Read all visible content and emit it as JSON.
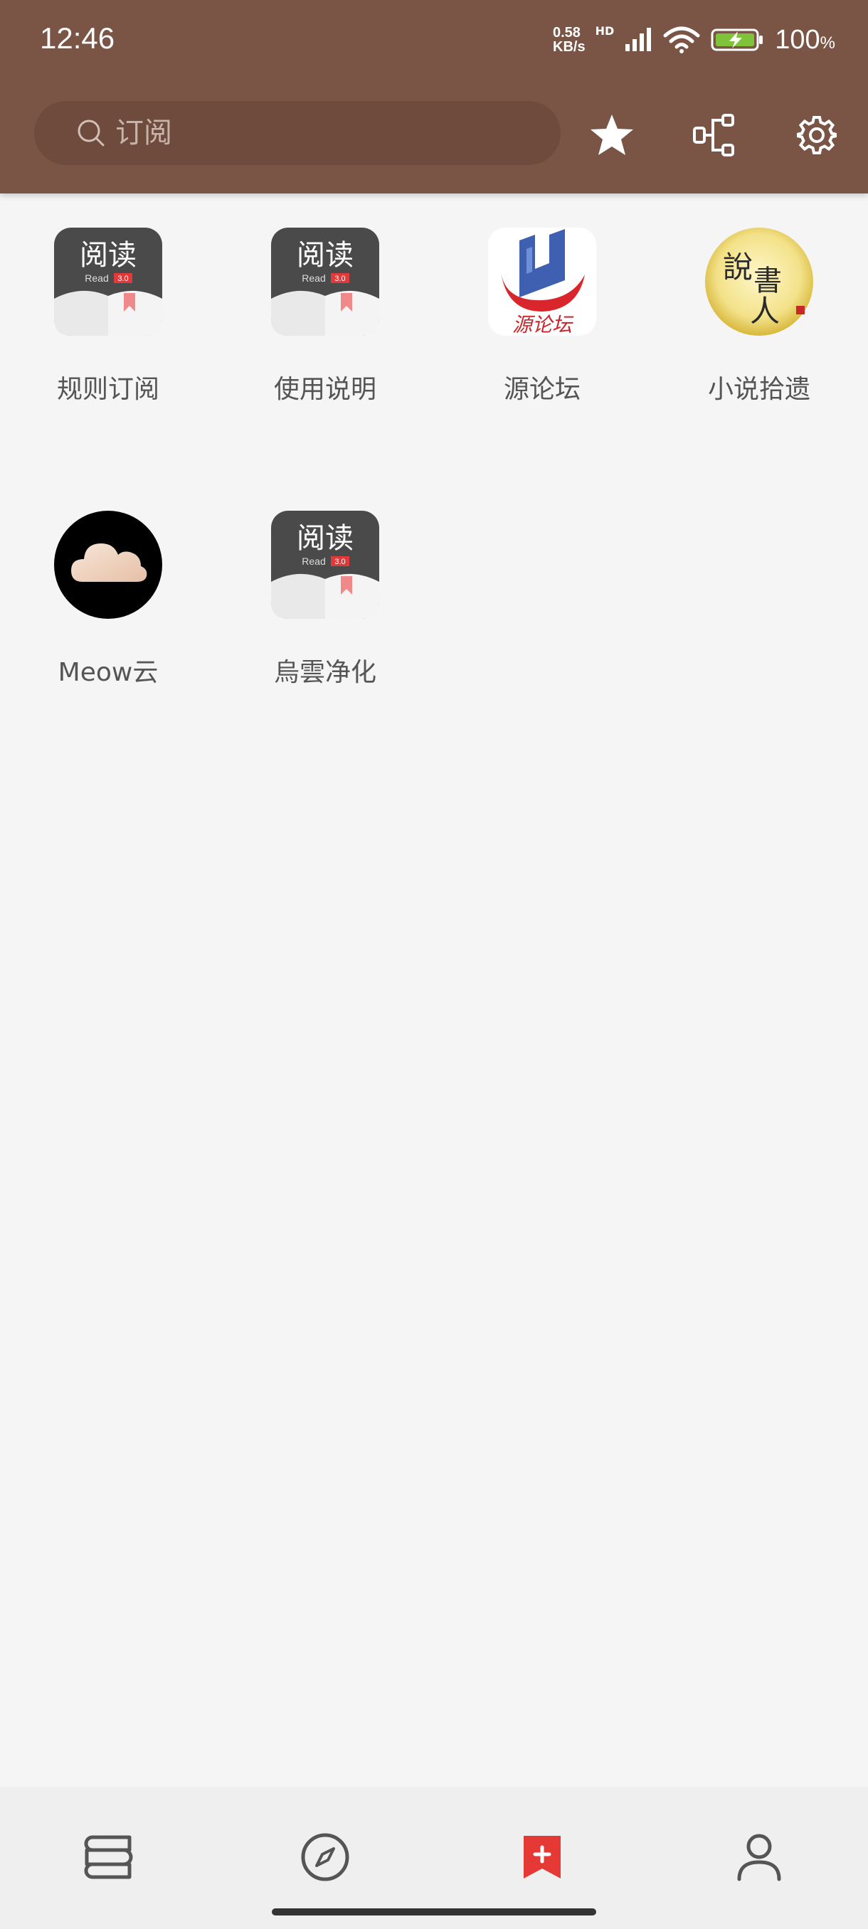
{
  "status_bar": {
    "time": "12:46",
    "net_speed_value": "0.58",
    "net_speed_unit": "KB/s",
    "hd": "HD",
    "battery_percent": "100",
    "battery_unit": "%"
  },
  "search": {
    "placeholder": "订阅",
    "value": ""
  },
  "toolbar": {
    "star_icon": "star-icon",
    "group_icon": "rule-tree-icon",
    "settings_icon": "gear-icon"
  },
  "sources": [
    {
      "label": "规则订阅",
      "icon": "yuedu-book-icon"
    },
    {
      "label": "使用说明",
      "icon": "yuedu-book-icon"
    },
    {
      "label": "源论坛",
      "icon": "forum-logo-icon"
    },
    {
      "label": "小说拾遗",
      "icon": "shuo-shu-ren-icon"
    },
    {
      "label": "Meow云",
      "icon": "cloud-icon"
    },
    {
      "label": "烏雲净化",
      "icon": "yuedu-book-icon"
    }
  ],
  "icon_text": {
    "yuedu": "阅读",
    "read": "Read",
    "version": "3.0",
    "forum": "源论坛",
    "shuo": "說",
    "shu": "書",
    "ren": "人"
  },
  "bottom_nav": [
    {
      "icon": "bookshelf-icon",
      "active": false
    },
    {
      "icon": "compass-icon",
      "active": false
    },
    {
      "icon": "bookmark-plus-icon",
      "active": true
    },
    {
      "icon": "person-icon",
      "active": false
    }
  ],
  "colors": {
    "appbar": "#7a5546",
    "accent": "#e53935",
    "background": "#f5f5f5"
  }
}
